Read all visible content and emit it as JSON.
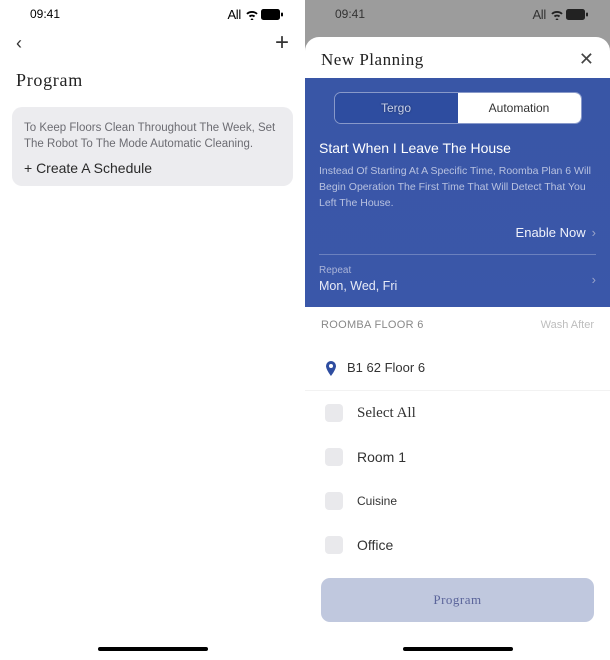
{
  "status": {
    "time": "09:41",
    "carrier": "All"
  },
  "left": {
    "title": "Program",
    "card": {
      "desc": "To Keep Floors Clean Throughout The Week, Set The Robot To The Mode Automatic Cleaning.",
      "action": "+ Create A Schedule"
    }
  },
  "right": {
    "sheet_title": "New Planning",
    "segmented": {
      "active": "Tergo",
      "inactive": "Automation"
    },
    "panel": {
      "title": "Start When I Leave The House",
      "desc": "Instead Of Starting At A Specific Time, Roomba Plan 6 Will Begin Operation The First Time That Will Detect That You Left The House.",
      "enable": "Enable Now",
      "repeat_label": "Repeat",
      "repeat_value": "Mon, Wed, Fri"
    },
    "section": {
      "left": "ROOMBA FLOOR 6",
      "right": "Wash After"
    },
    "location": "B1 62 Floor 6",
    "rooms": {
      "select_all": "Select All",
      "r1": "Room 1",
      "r2": "Cuisine",
      "r3": "Office"
    },
    "program_btn": "Program"
  }
}
